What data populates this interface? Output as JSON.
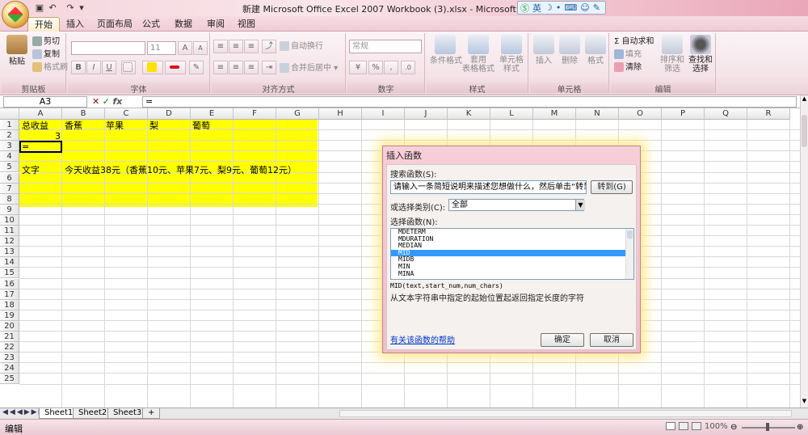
{
  "window": {
    "title": "新建 Microsoft Office Excel 2007 Workbook (3).xlsx - Microsoft Exc",
    "ime_label": "英"
  },
  "ribbon": {
    "tabs": [
      "开始",
      "插入",
      "页面布局",
      "公式",
      "数据",
      "审阅",
      "视图"
    ],
    "clipboard": {
      "paste": "粘贴",
      "cut": "剪切",
      "copy": "复制",
      "format_painter": "格式刷",
      "label": "剪贴板"
    },
    "font": {
      "font_name": "",
      "font_size": "11",
      "label": "字体",
      "bold": "B",
      "italic": "I",
      "underline": "U",
      "grow": "A",
      "shrink": "A"
    },
    "alignment": {
      "wrap": "自动换行",
      "merge": "合并后居中",
      "label": "对齐方式"
    },
    "number": {
      "format": "常规",
      "percent": "%",
      "comma": ",",
      "label": "数字"
    },
    "styles": {
      "conditional": "条件格式",
      "table": "套用\n表格格式",
      "cell": "单元格\n样式",
      "label": "样式"
    },
    "cells": {
      "insert": "插入",
      "delete": "删除",
      "format": "格式",
      "label": "单元格"
    },
    "editing": {
      "autosum": "Σ 自动求和",
      "fill": "填充",
      "clear": "清除",
      "sort": "排序和\n筛选",
      "find": "查找和\n选择",
      "label": "编辑"
    }
  },
  "formula_bar": {
    "name_box": "A3",
    "formula": "="
  },
  "sheet": {
    "columns": [
      "A",
      "B",
      "C",
      "D",
      "E",
      "F",
      "G",
      "H",
      "I",
      "J",
      "K",
      "L",
      "M",
      "N",
      "O",
      "P",
      "Q",
      "R"
    ],
    "rows": [
      "1",
      "2",
      "3",
      "4",
      "5",
      "6",
      "7",
      "8",
      "9",
      "10",
      "11",
      "12",
      "13",
      "14",
      "15",
      "16",
      "17",
      "18",
      "19",
      "20",
      "21",
      "22",
      "23",
      "24",
      "25"
    ],
    "cells": {
      "a1": "总收益",
      "b1": "香蕉",
      "c1": "苹果",
      "d1": "梨",
      "e1": "葡萄",
      "a2": "3",
      "a3": "=",
      "a5": "文字",
      "b5": "今天收益38元（香蕉10元、苹果7元、梨9元、葡萄12元）"
    },
    "tabs": [
      "Sheet1",
      "Sheet2",
      "Sheet3"
    ],
    "highlight_color": "#ffff00"
  },
  "dialog": {
    "title": "插入函数",
    "search_label": "搜索函数(S):",
    "search_placeholder": "请输入一条简短说明来描述您想做什么，然后单击“转到”",
    "go_button": "转到(G)",
    "category_label": "或选择类别(C):",
    "category_value": "全部",
    "function_label": "选择函数(N):",
    "functions": [
      "MDETERM",
      "MDURATION",
      "MEDIAN",
      "MID",
      "MIDB",
      "MIN",
      "MINA"
    ],
    "selected_function": "MID",
    "signature": "MID(text,start_num,num_chars)",
    "description": "从文本字符串中指定的起始位置起返回指定长度的字符",
    "help_link": "有关该函数的帮助",
    "ok_button": "确定",
    "cancel_button": "取消"
  },
  "status": {
    "mode": "编辑",
    "zoom": "100%"
  }
}
